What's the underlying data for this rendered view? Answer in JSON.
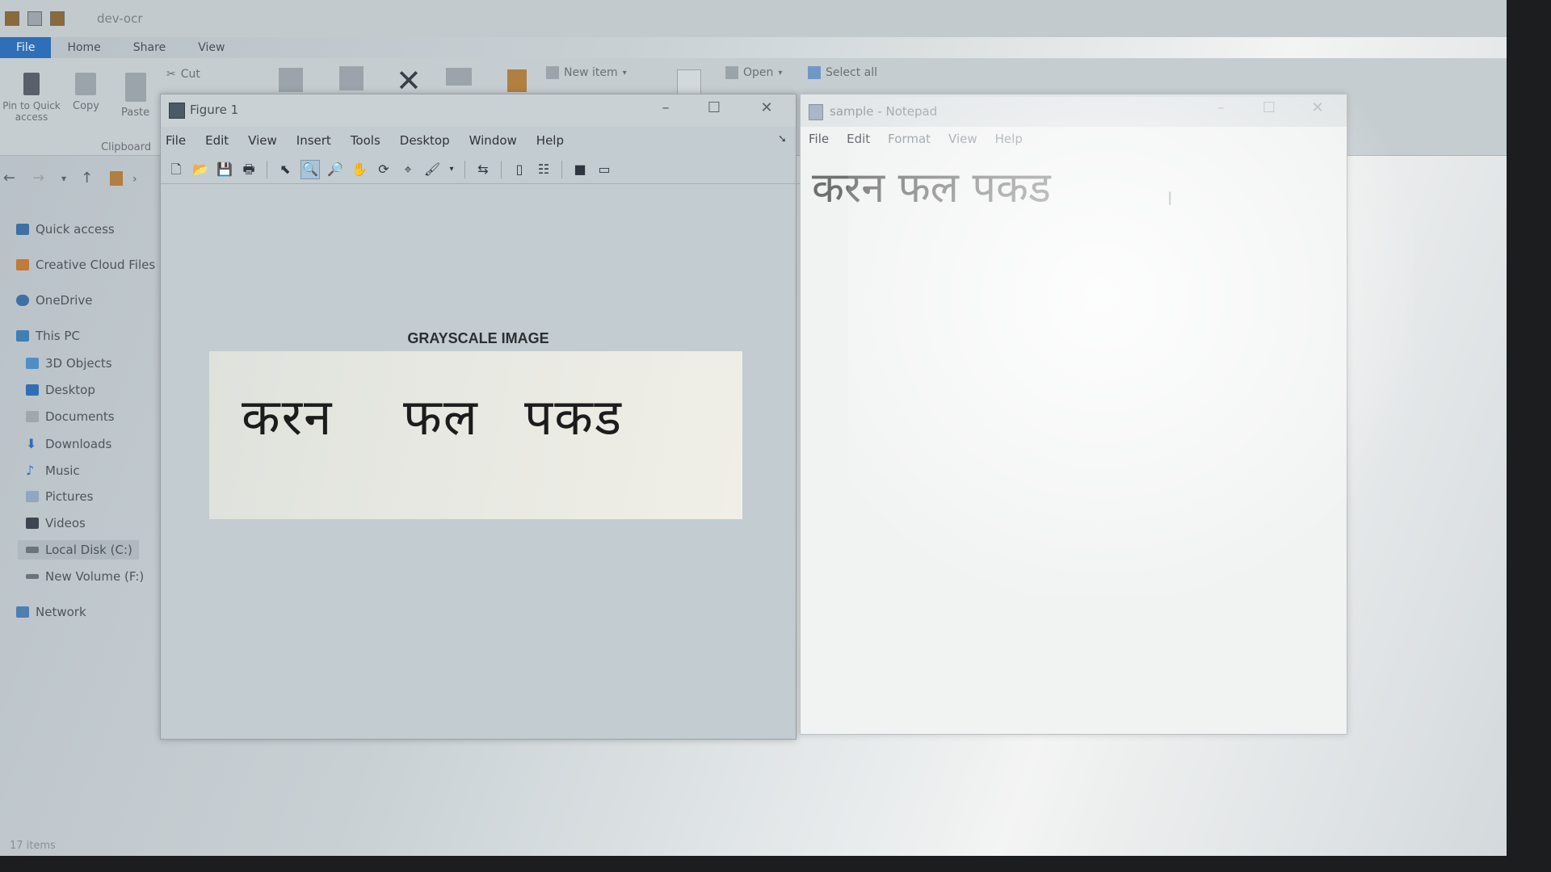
{
  "explorer": {
    "title": "dev-ocr",
    "tabs": [
      "File",
      "Home",
      "Share",
      "View"
    ],
    "ribbon": {
      "pin_label": "Pin to Quick access",
      "copy_label": "Copy",
      "paste_label": "Paste",
      "cut_label": "Cut",
      "new_item_label": "New item",
      "open_label": "Open",
      "select_all_label": "Select all",
      "clipboard_group": "Clipboard"
    },
    "nav": {
      "quick_access": "Quick access",
      "creative_cloud": "Creative Cloud Files",
      "onedrive": "OneDrive",
      "this_pc": "This PC",
      "objects3d": "3D Objects",
      "desktop": "Desktop",
      "documents": "Documents",
      "downloads": "Downloads",
      "music": "Music",
      "pictures": "Pictures",
      "videos": "Videos",
      "local_disk": "Local Disk (C:)",
      "new_volume": "New Volume (F:)",
      "network": "Network"
    },
    "status": "17 items"
  },
  "figure": {
    "title": "Figure 1",
    "menu": [
      "File",
      "Edit",
      "View",
      "Insert",
      "Tools",
      "Desktop",
      "Window",
      "Help"
    ],
    "axes_title": "GRAYSCALE IMAGE",
    "image_words": [
      "करन",
      "फल",
      "पकड"
    ]
  },
  "notepad": {
    "title": "sample - Notepad",
    "menu": [
      "File",
      "Edit",
      "Format",
      "View",
      "Help"
    ],
    "content": "करन फल पकड"
  },
  "colors": {
    "file_tab": "#2f6fb8",
    "toolbar_active": "#a9c3d8"
  }
}
